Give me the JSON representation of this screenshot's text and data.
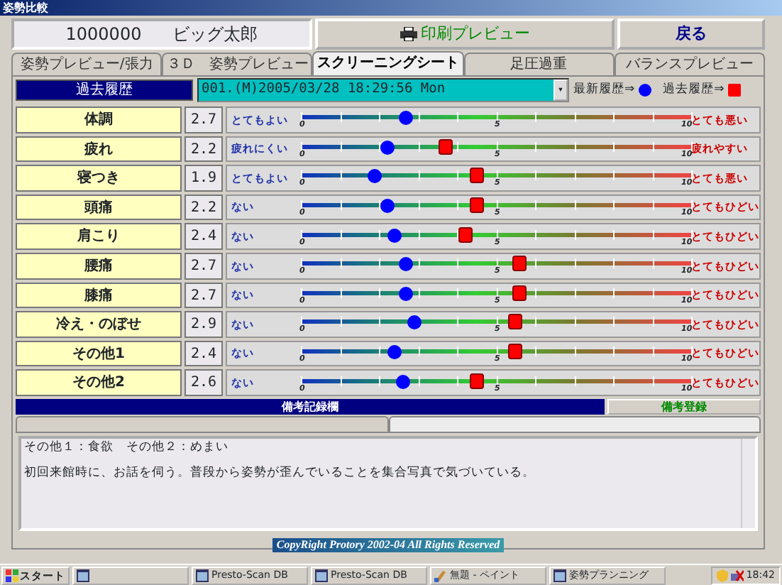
{
  "window": {
    "title": "姿勢比較"
  },
  "header": {
    "patient_id": "1000000",
    "patient_name": "ビッグ太郎",
    "print_button": "印刷プレビュー",
    "back_button": "戻る"
  },
  "tabs": [
    {
      "label": "姿勢プレビュー/張力",
      "selected": false
    },
    {
      "label": "３Ｄ　姿勢プレビュー",
      "selected": false
    },
    {
      "label": "スクリーニングシート",
      "selected": true
    },
    {
      "label": "足圧過重",
      "selected": false
    },
    {
      "label": "バランスプレビュー",
      "selected": false
    }
  ],
  "history": {
    "label": "過去履歴",
    "value": "001.(M)2005/03/28 18:29:56 Mon",
    "dropdown_arrow": "▾",
    "latest_legend": "最新履歴⇒",
    "past_legend": "過去履歴⇒"
  },
  "items": [
    {
      "name": "体調",
      "score": "2.7",
      "low_label": "とてもよい",
      "high_label": "とても悪い",
      "scale": [
        "0",
        "5",
        "10"
      ],
      "latest": {
        "level": 0.27
      }
    },
    {
      "name": "疲れ",
      "score": "2.2",
      "low_label": "疲れにくい",
      "high_label": "疲れやすい",
      "scale": [
        "0",
        "5",
        "10"
      ],
      "latest": {
        "level": 0.22
      },
      "past": {
        "level": 0.37
      }
    },
    {
      "name": "寝つき",
      "score": "1.9",
      "low_label": "とてもよい",
      "high_label": "とても悪い",
      "scale": [
        "0",
        "5",
        "10"
      ],
      "latest": {
        "level": 0.19
      },
      "past": {
        "level": 0.45
      }
    },
    {
      "name": "頭痛",
      "score": "2.2",
      "low_label": "ない",
      "high_label": "とてもひどい",
      "scale": [
        "0",
        "5",
        "10"
      ],
      "latest": {
        "level": 0.22
      },
      "past": {
        "level": 0.45
      }
    },
    {
      "name": "肩こり",
      "score": "2.4",
      "low_label": "ない",
      "high_label": "とてもひどい",
      "scale": [
        "0",
        "5",
        "10"
      ],
      "latest": {
        "level": 0.24
      },
      "past": {
        "level": 0.42
      }
    },
    {
      "name": "腰痛",
      "score": "2.7",
      "low_label": "ない",
      "high_label": "とてもひどい",
      "scale": [
        "0",
        "5",
        "10"
      ],
      "latest": {
        "level": 0.27
      },
      "past": {
        "level": 0.56
      }
    },
    {
      "name": "膝痛",
      "score": "2.7",
      "low_label": "ない",
      "high_label": "とてもひどい",
      "scale": [
        "0",
        "5",
        "10"
      ],
      "latest": {
        "level": 0.27
      },
      "past": {
        "level": 0.56
      }
    },
    {
      "name": "冷え・のぼせ",
      "score": "2.9",
      "low_label": "ない",
      "high_label": "とてもひどい",
      "scale": [
        "0",
        "5",
        "10"
      ],
      "latest": {
        "level": 0.29
      },
      "past": {
        "level": 0.55
      }
    },
    {
      "name": "その他1",
      "score": "2.4",
      "low_label": "ない",
      "high_label": "とてもひどい",
      "scale": [
        "0",
        "5",
        "10"
      ],
      "latest": {
        "level": 0.24
      },
      "past": {
        "level": 0.55
      }
    },
    {
      "name": "その他2",
      "score": "2.6",
      "low_label": "ない",
      "high_label": "とてもひどい",
      "scale": [
        "0",
        "5",
        "10"
      ],
      "latest": {
        "level": 0.26
      },
      "past": {
        "level": 0.45
      }
    }
  ],
  "notes": {
    "title": "備考記録欄",
    "register_button": "備考登録",
    "subtabs": [
      {
        "selected": false
      },
      {
        "selected": true
      }
    ],
    "lines": [
      "その他１：食欲　その他２：めまい",
      "初回来館時に、お話を伺う。普段から姿勢が歪んでいることを集合写真で気づいている。"
    ]
  },
  "footer": "CopyRight Protory 2002-04 All Rights Reserved",
  "taskbar": {
    "start": "スタート",
    "items": [
      {
        "kind": "window"
      },
      {
        "kind": "window",
        "label": "Presto-Scan DB"
      },
      {
        "kind": "window",
        "label": "Presto-Scan DB"
      },
      {
        "kind": "paint",
        "label": "無題 - ペイント"
      },
      {
        "kind": "window",
        "label": "姿勢プランニング"
      }
    ],
    "clock": "18:42"
  }
}
